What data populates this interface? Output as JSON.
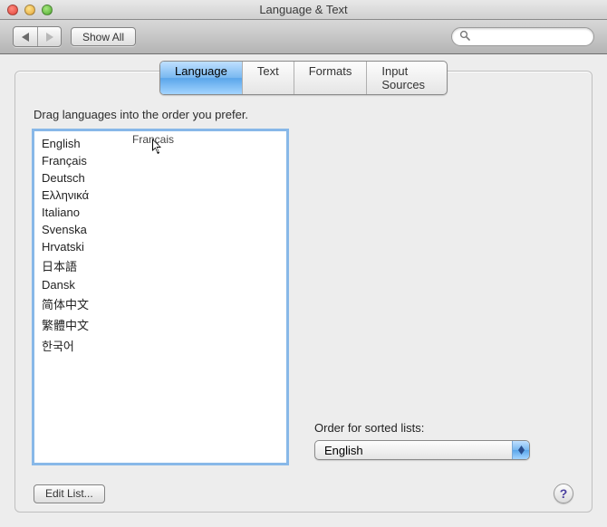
{
  "window": {
    "title": "Language & Text"
  },
  "toolbar": {
    "show_all": "Show All",
    "search_placeholder": ""
  },
  "tabs": {
    "language": "Language",
    "text": "Text",
    "formats": "Formats",
    "input_sources": "Input Sources"
  },
  "instruction": "Drag languages into the order you prefer.",
  "languages": [
    "English",
    "Français",
    "Deutsch",
    "Ελληνικά",
    "Italiano",
    "Svenska",
    "Hrvatski",
    "日本語",
    "Dansk",
    "简体中文",
    "繁體中文",
    "한국어"
  ],
  "drag_ghost": "Français",
  "sort": {
    "label": "Order for sorted lists:",
    "value": "English"
  },
  "edit_list": "Edit List...",
  "help": "?"
}
